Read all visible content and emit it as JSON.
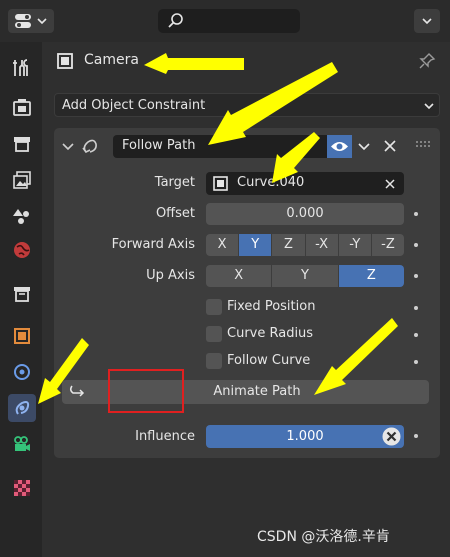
{
  "header": {
    "editor_icon": "properties-editor-icon",
    "search_icon": "search-icon",
    "dropdown_icon": "chevron-down-icon"
  },
  "sidebar": {
    "tabs": [
      {
        "icon": "tool-icon"
      },
      {
        "icon": "render-icon"
      },
      {
        "icon": "output-icon"
      },
      {
        "icon": "view-layer-icon"
      },
      {
        "icon": "scene-icon"
      },
      {
        "icon": "world-icon"
      },
      {
        "icon": "collection-icon"
      },
      {
        "icon": "object-icon"
      },
      {
        "icon": "modifier-icon"
      },
      {
        "icon": "constraint-icon",
        "active": true
      },
      {
        "icon": "object-data-camera-icon"
      },
      {
        "icon": "texture-icon"
      }
    ]
  },
  "object": {
    "name": "Camera",
    "pin_icon": "pin-icon"
  },
  "add_constraint": {
    "label": "Add Object Constraint"
  },
  "constraint": {
    "name": "Follow Path",
    "target_label": "Target",
    "target_value": "Curve.040",
    "offset_label": "Offset",
    "offset_value": "0.000",
    "forward_axis_label": "Forward Axis",
    "forward_axis_options": [
      "X",
      "Y",
      "Z",
      "-X",
      "-Y",
      "-Z"
    ],
    "forward_axis_selected": "Y",
    "up_axis_label": "Up Axis",
    "up_axis_options": [
      "X",
      "Y",
      "Z"
    ],
    "up_axis_selected": "Z",
    "fixed_position_label": "Fixed Position",
    "curve_radius_label": "Curve Radius",
    "follow_curve_label": "Follow Curve",
    "animate_path_label": "Animate Path",
    "influence_label": "Influence",
    "influence_value": "1.000"
  },
  "watermark": "CSDN @沃洛德.辛肯",
  "colors": {
    "accent": "#4772b3",
    "annotation_arrow": "#ffff00",
    "annotation_box": "#e02020"
  }
}
